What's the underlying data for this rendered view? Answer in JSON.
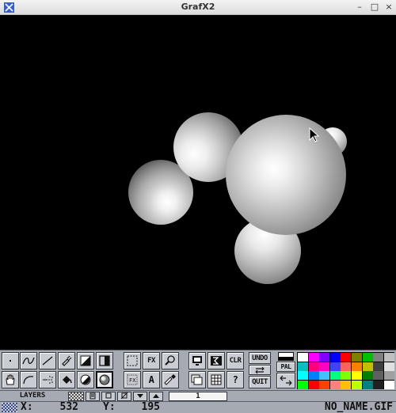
{
  "window": {
    "title": "GrafX2",
    "minimize": "–",
    "maximize": "□",
    "close": "×"
  },
  "toolbar": {
    "fx_label": "FX",
    "text_tool_label": "A",
    "clear_label": "CLR",
    "undo_label": "UNDO",
    "quit_label": "QUIT",
    "help_label": "?",
    "pal_label": "PAL",
    "fx_small_label": "FX"
  },
  "palette": {
    "colors": [
      [
        "#ffffff",
        "#ff00ff",
        "#8000ff",
        "#0000ff",
        "#ff0000",
        "#808000",
        "#00c000",
        "#808080",
        "#c0c0c0"
      ],
      [
        "#00c0c0",
        "#ff0080",
        "#ff00c0",
        "#4040ff",
        "#ff6060",
        "#ff8000",
        "#c0c000",
        "#404040",
        "#e0e0e0"
      ],
      [
        "#00ffff",
        "#0080ff",
        "#40c0ff",
        "#00ff80",
        "#80ff00",
        "#ffff00",
        "#008000",
        "#606060",
        "#a0a0a0"
      ],
      [
        "#00ff00",
        "#ff0000",
        "#ff4000",
        "#ff8080",
        "#ffc000",
        "#c0ff00",
        "#008080",
        "#202020",
        "#ffffff"
      ]
    ],
    "fore_color": "#ffffff",
    "back_color": "#000000"
  },
  "layers": {
    "label": "LAYERS",
    "current": "1"
  },
  "status": {
    "x_label": "X:",
    "x_value": "532",
    "y_label": "Y:",
    "y_value": "195",
    "filename": "NO_NAME.GIF"
  }
}
